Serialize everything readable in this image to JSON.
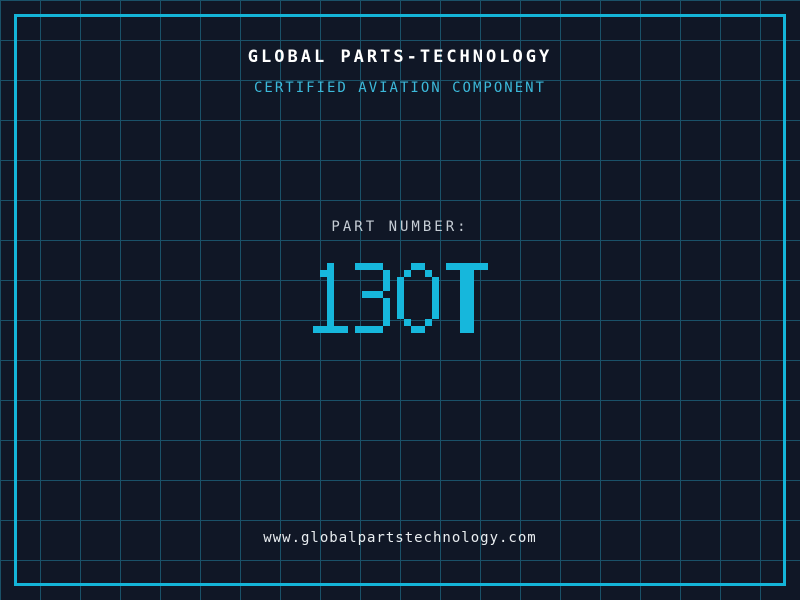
{
  "theme": {
    "background": "#101726",
    "grid_line": "#1a5168",
    "border": "#14b4d8",
    "accent": "#16b7dc",
    "subtitle_color": "#3cb9da",
    "title_color": "#ffffff",
    "label_color": "#c6cdd5",
    "url_color": "#e9edf0"
  },
  "header": {
    "title": "GLOBAL PARTS-TECHNOLOGY",
    "subtitle": "CERTIFIED AVIATION COMPONENT"
  },
  "part": {
    "label": "PART NUMBER:",
    "number": "130T"
  },
  "footer": {
    "url": "www.globalpartstechnology.com"
  }
}
